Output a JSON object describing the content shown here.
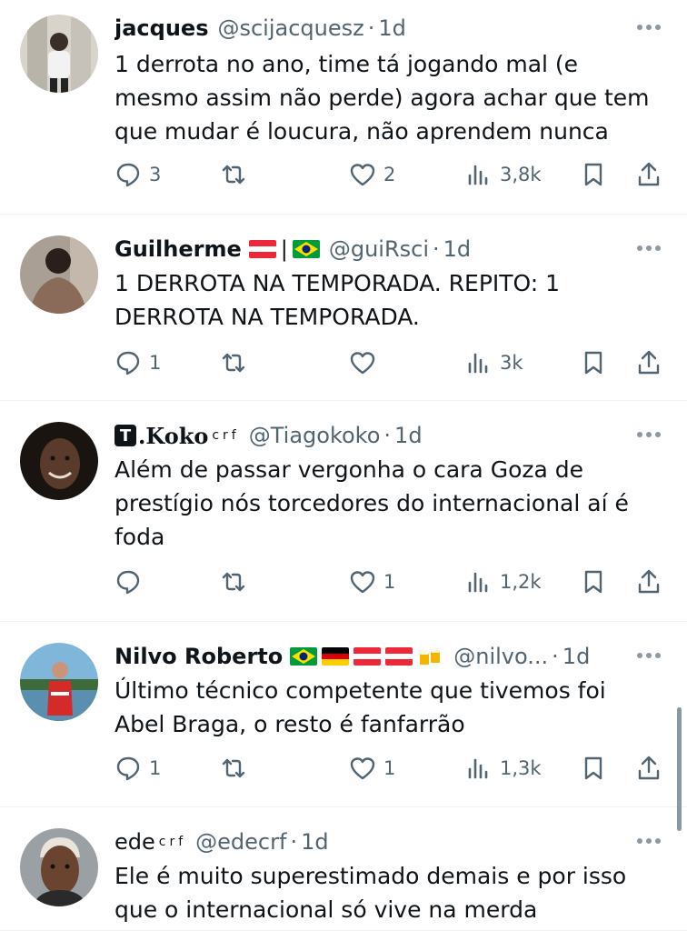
{
  "tweets": [
    {
      "name": "jacques",
      "handle": "@scijacquesz",
      "dot": "·",
      "time": "1d",
      "text": "1 derrota no ano, time tá jogando mal (e\nmesmo assim não perde) agora achar que tem\nque mudar é loucura, não aprendem nunca",
      "replies": "3",
      "retweets": "",
      "likes": "2",
      "views": "3,8k"
    },
    {
      "name": "Guilherme",
      "flags_text": "|",
      "handle": "@guiRsci",
      "dot": "·",
      "time": "1d",
      "text": "1 DERROTA NA TEMPORADA. REPITO: 1\nDERROTA NA TEMPORADA.",
      "replies": "1",
      "retweets": "",
      "likes": "",
      "views": "3k"
    },
    {
      "name_badge": "T",
      "name": ".Koko",
      "sup": "crf",
      "handle": "@Tiagokoko",
      "dot": "·",
      "time": "1d",
      "text": "Além de passar vergonha o cara Goza de\nprestígio nós torcedores do internacional aí é\nfoda",
      "replies": "",
      "retweets": "",
      "likes": "1",
      "views": "1,2k"
    },
    {
      "name": "Nilvo Roberto",
      "handle": "@nilvo...",
      "dot": "·",
      "time": "1d",
      "text": "Último técnico competente que tivemos foi\nAbel Braga, o resto é fanfarrão",
      "replies": "1",
      "retweets": "",
      "likes": "1",
      "views": "1,3k"
    },
    {
      "name": "ede",
      "sup": "crf",
      "handle": "@edecrf",
      "dot": "·",
      "time": "1d",
      "text": "Ele é muito superestimado demais e por isso\nque o internacional só vive na merda"
    }
  ],
  "icons": {
    "reply": "reply-icon",
    "retweet": "retweet-icon",
    "like": "heart-icon",
    "views": "views-icon",
    "bookmark": "bookmark-icon",
    "share": "share-icon",
    "more": "more-icon"
  },
  "colors": {
    "text": "#0f1419",
    "secondary": "#536471",
    "divider": "#eff3f4"
  }
}
